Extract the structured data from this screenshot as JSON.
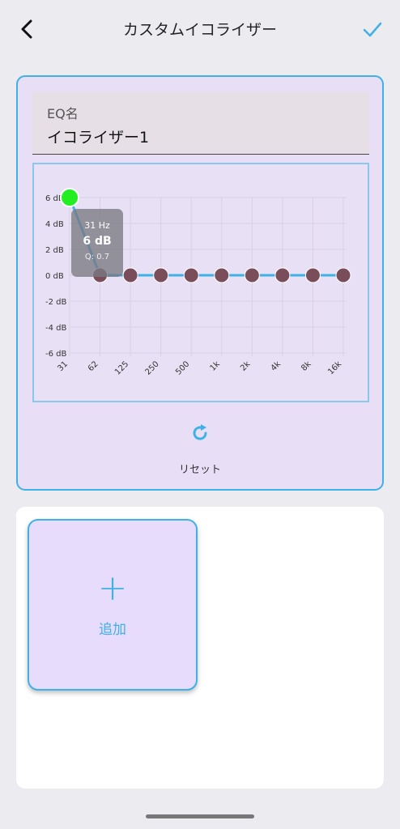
{
  "header": {
    "title": "カスタムイコライザー",
    "back_icon": "chevron-left-icon",
    "confirm_icon": "checkmark-icon",
    "accent_color": "#3fb1e6"
  },
  "eq_name": {
    "label": "EQ名",
    "value": "イコライザー1"
  },
  "tooltip": {
    "freq": "31 Hz",
    "gain": "6 dB",
    "q": "Q: 0.7"
  },
  "chart_data": {
    "type": "line",
    "x": [
      "31",
      "62",
      "125",
      "250",
      "500",
      "1k",
      "2k",
      "4k",
      "8k",
      "16k"
    ],
    "series": [
      {
        "values": [
          6,
          0,
          0,
          0,
          0,
          0,
          0,
          0,
          0,
          0
        ]
      }
    ],
    "yticks": [
      "6 dB",
      "4 dB",
      "2 dB",
      "0 dB",
      "-2 dB",
      "-4 dB",
      "-6 dB"
    ],
    "ylim": [
      -6,
      6
    ],
    "grid": true,
    "selected_index": 0,
    "colors": {
      "line": "#3fb1e6",
      "point": "#7a4d5a",
      "selected": "#22ee22"
    }
  },
  "reset": {
    "icon": "refresh-icon",
    "label": "リセット"
  },
  "presets": {
    "add_icon": "plus-icon",
    "add_label": "追加"
  }
}
